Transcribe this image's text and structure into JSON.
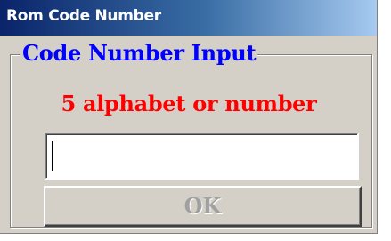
{
  "window": {
    "title": "Rom Code Number"
  },
  "group": {
    "legend": "Code Number Input",
    "hint": "5 alphabet or number"
  },
  "code_input": {
    "value": "",
    "placeholder": ""
  },
  "ok_button": {
    "label": "OK",
    "state": "disabled"
  },
  "colors": {
    "title_bar": "#0a246a",
    "legend_text": "#0000ff",
    "hint_text": "#ff0000",
    "dialog_face": "#d4d0c8",
    "disabled_text": "#a0a0a0"
  }
}
